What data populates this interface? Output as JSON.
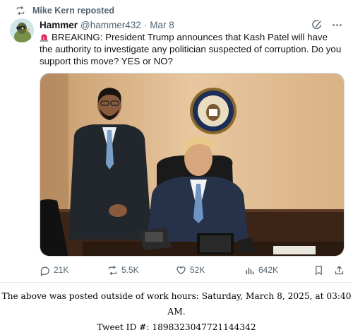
{
  "repost": {
    "label": "Mike Kern reposted",
    "icon": "repost-icon"
  },
  "author": {
    "name": "Hammer",
    "handle": "@hammer432",
    "separator": "·",
    "date": "Mar 8"
  },
  "header_icons": [
    "grok-icon",
    "more-icon"
  ],
  "tweet": {
    "emoji": "siren-icon",
    "text": "BREAKING: President Trump announces that Kash Patel will have the authority to investigate any politician suspected of corruption. Do you support this move? YES or NO?"
  },
  "media": {
    "description_icon": "photo"
  },
  "actions": {
    "replies": "21K",
    "reposts": "5.5K",
    "likes": "52K",
    "views": "642K"
  },
  "footer": {
    "line1": "The above was posted outside of work hours: Saturday, March 8, 2025, at 03:40 AM.",
    "line2": "Tweet ID #: 1898323047721144342"
  },
  "colors": {
    "secondary_text": "#536471",
    "primary_text": "#0f1419",
    "siren_red": "#e0245e"
  }
}
